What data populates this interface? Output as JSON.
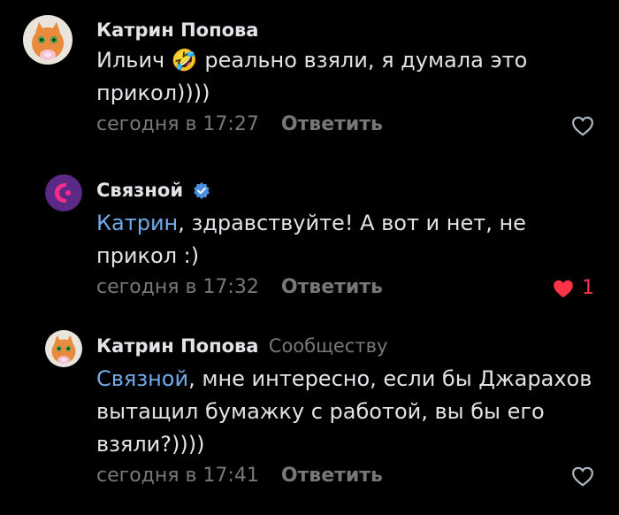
{
  "comments": [
    {
      "author": "Катрин Попова",
      "text": "Ильич 🤣 реально взяли, я думала это прикол))))",
      "time": "сегодня в 17:27",
      "reply_label": "Ответить",
      "likes": ""
    },
    {
      "author": "Связной",
      "mention": "Катрин",
      "text": ", здравствуйте! А вот и нет, не прикол :)",
      "time": "сегодня в 17:32",
      "reply_label": "Ответить",
      "likes": "1"
    },
    {
      "author": "Катрин Попова",
      "sub_note": "Сообществу",
      "mention": "Связной",
      "text": ", мне интересно, если бы Джарахов вытащил бумажку с работой, вы бы его взяли?))))",
      "time": "сегодня в 17:41",
      "reply_label": "Ответить",
      "likes": ""
    }
  ],
  "colors": {
    "background": "#000000",
    "text": "#e1e3e6",
    "secondary": "#76787a",
    "mention": "#71aaeb",
    "liked": "#ff3347",
    "verified": "#4a8fe0"
  },
  "icons": [
    "cat-avatar",
    "svyaznoy-logo",
    "verified-icon",
    "heart-outline-icon",
    "heart-filled-icon"
  ]
}
